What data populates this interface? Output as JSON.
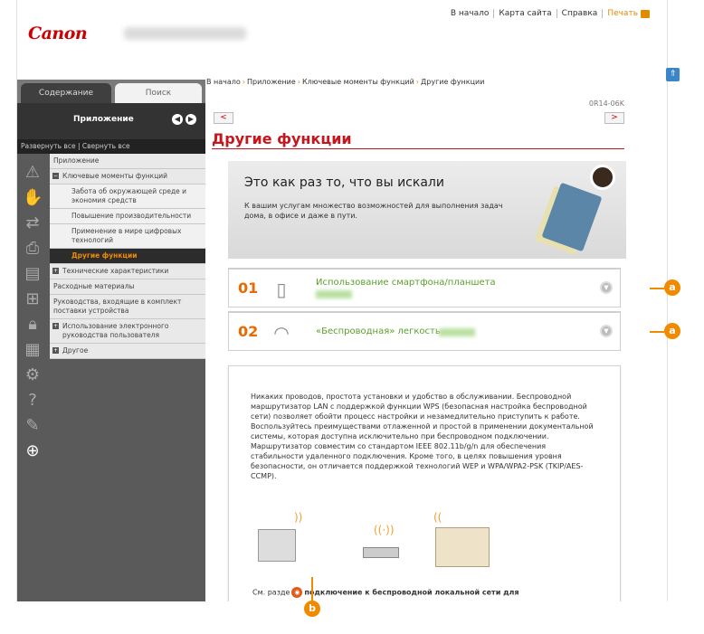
{
  "header": {
    "logo": "Canon",
    "links": [
      "В начало",
      "Карта сайта",
      "Справка"
    ],
    "print_label": "Печать"
  },
  "sidebar": {
    "tab_contents": "Содержание",
    "tab_search": "Поиск",
    "section_title": "Приложение",
    "expand_collapse": "Развернуть все | Свернуть все",
    "items": [
      {
        "label": "Приложение"
      },
      {
        "label": "Ключевые моменты функций"
      },
      {
        "label": "Забота об окружающей среде и экономия средств"
      },
      {
        "label": "Повышение производительности"
      },
      {
        "label": "Применение в мире цифровых технологий"
      },
      {
        "label": "Другие функции"
      },
      {
        "label": "Технические характеристики"
      },
      {
        "label": "Расходные материалы"
      },
      {
        "label": "Руководства, входящие в комплект поставки устройства"
      },
      {
        "label": "Использование электронного руководства пользователя"
      },
      {
        "label": "Другое"
      }
    ]
  },
  "main": {
    "breadcrumb": [
      "В начало",
      "Приложение",
      "Ключевые моменты функций",
      "Другие функции"
    ],
    "code": "0R14-06K",
    "title": "Другие функции",
    "banner_title": "Это как раз то, что вы искали",
    "banner_sub": "К вашим услугам множество возможностей для выполнения задач дома, в офисе и даже в пути.",
    "features": [
      {
        "num": "01",
        "text": "Использование смартфона/планшета"
      },
      {
        "num": "02",
        "text": "«Беспроводная» легкость"
      }
    ],
    "description": "Никаких проводов, простота установки и удобство в обслуживании. Беспроводной маршрутизатор LAN с поддержкой функции WPS (безопасная настройка беспроводной сети) позволяет обойти процесс настройки и незамедлительно приступить к работе. Воспользуйтесь преимуществами отлаженной и простой в применении документальной системы, которая доступна исключительно при беспроводном подключении. Маршрутизатор совместим со стандартом IEEE 802.11b/g/n для обеспечения стабильности удаленного подключения. Кроме того, в целях повышения уровня безопасности, он отличается поддержкой технологий WEP и WPA/WPA2-PSK (TKIP/AES-CCMP).",
    "see_prefix": "См. разде",
    "see_link": "подключение к беспроводной локальной сети для"
  },
  "callouts": {
    "a": "a",
    "b": "b"
  }
}
